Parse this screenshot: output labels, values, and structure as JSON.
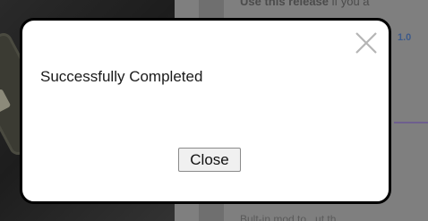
{
  "background": {
    "top_text_bold": "Use this release",
    "top_text_rest": " if you a",
    "link_fragment": "1.0",
    "bottom_text": "Bult-in mod to...ut th"
  },
  "dialog": {
    "message": "Successfully Completed",
    "close_button_label": "Close",
    "close_icon": "close-x-icon"
  }
}
